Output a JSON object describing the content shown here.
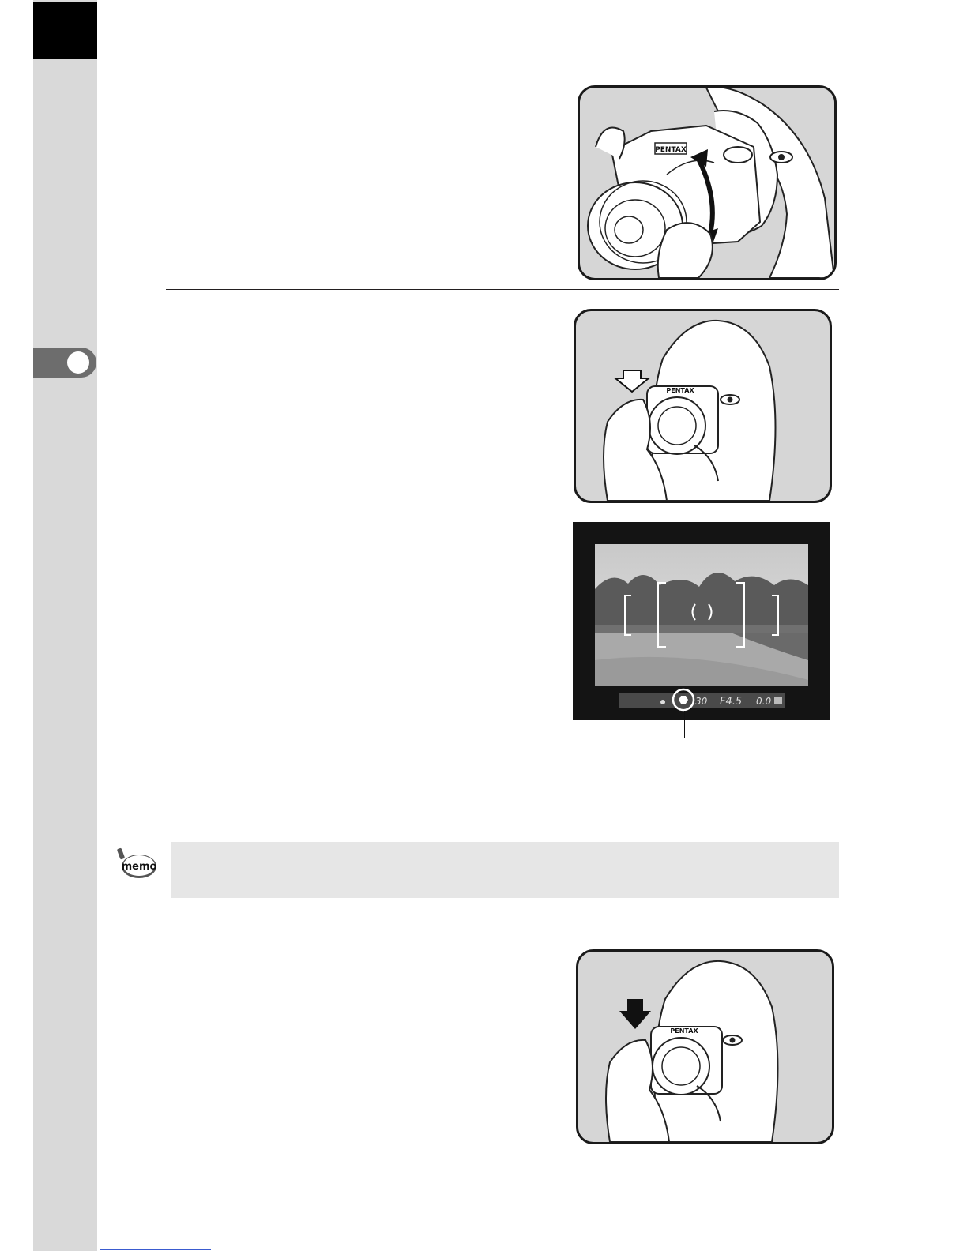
{
  "viewfinder": {
    "aperture": "F4.5",
    "ev": "0.0"
  },
  "memo": {
    "badge": "memo"
  },
  "illustrations": {
    "camera_brand": "PENTAX"
  },
  "colors": {
    "strip": "#d9d9d9",
    "tab": "#6d6d6d",
    "panel": "#d6d6d6",
    "memo_box": "#e6e6e6",
    "rule": "#231f20"
  },
  "icons": [
    "memo-icon",
    "focus-indicator-icon",
    "flash-icon",
    "arrow-press-icon"
  ]
}
